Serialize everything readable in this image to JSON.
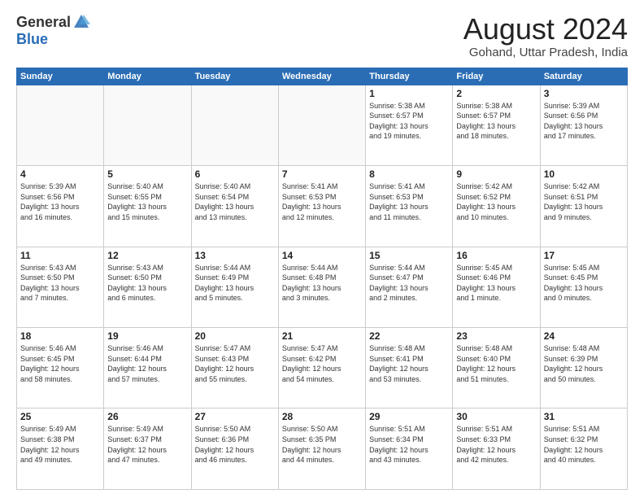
{
  "header": {
    "logo_general": "General",
    "logo_blue": "Blue",
    "title": "August 2024",
    "location": "Gohand, Uttar Pradesh, India"
  },
  "days_of_week": [
    "Sunday",
    "Monday",
    "Tuesday",
    "Wednesday",
    "Thursday",
    "Friday",
    "Saturday"
  ],
  "weeks": [
    [
      {
        "day": "",
        "info": ""
      },
      {
        "day": "",
        "info": ""
      },
      {
        "day": "",
        "info": ""
      },
      {
        "day": "",
        "info": ""
      },
      {
        "day": "1",
        "info": "Sunrise: 5:38 AM\nSunset: 6:57 PM\nDaylight: 13 hours\nand 19 minutes."
      },
      {
        "day": "2",
        "info": "Sunrise: 5:38 AM\nSunset: 6:57 PM\nDaylight: 13 hours\nand 18 minutes."
      },
      {
        "day": "3",
        "info": "Sunrise: 5:39 AM\nSunset: 6:56 PM\nDaylight: 13 hours\nand 17 minutes."
      }
    ],
    [
      {
        "day": "4",
        "info": "Sunrise: 5:39 AM\nSunset: 6:56 PM\nDaylight: 13 hours\nand 16 minutes."
      },
      {
        "day": "5",
        "info": "Sunrise: 5:40 AM\nSunset: 6:55 PM\nDaylight: 13 hours\nand 15 minutes."
      },
      {
        "day": "6",
        "info": "Sunrise: 5:40 AM\nSunset: 6:54 PM\nDaylight: 13 hours\nand 13 minutes."
      },
      {
        "day": "7",
        "info": "Sunrise: 5:41 AM\nSunset: 6:53 PM\nDaylight: 13 hours\nand 12 minutes."
      },
      {
        "day": "8",
        "info": "Sunrise: 5:41 AM\nSunset: 6:53 PM\nDaylight: 13 hours\nand 11 minutes."
      },
      {
        "day": "9",
        "info": "Sunrise: 5:42 AM\nSunset: 6:52 PM\nDaylight: 13 hours\nand 10 minutes."
      },
      {
        "day": "10",
        "info": "Sunrise: 5:42 AM\nSunset: 6:51 PM\nDaylight: 13 hours\nand 9 minutes."
      }
    ],
    [
      {
        "day": "11",
        "info": "Sunrise: 5:43 AM\nSunset: 6:50 PM\nDaylight: 13 hours\nand 7 minutes."
      },
      {
        "day": "12",
        "info": "Sunrise: 5:43 AM\nSunset: 6:50 PM\nDaylight: 13 hours\nand 6 minutes."
      },
      {
        "day": "13",
        "info": "Sunrise: 5:44 AM\nSunset: 6:49 PM\nDaylight: 13 hours\nand 5 minutes."
      },
      {
        "day": "14",
        "info": "Sunrise: 5:44 AM\nSunset: 6:48 PM\nDaylight: 13 hours\nand 3 minutes."
      },
      {
        "day": "15",
        "info": "Sunrise: 5:44 AM\nSunset: 6:47 PM\nDaylight: 13 hours\nand 2 minutes."
      },
      {
        "day": "16",
        "info": "Sunrise: 5:45 AM\nSunset: 6:46 PM\nDaylight: 13 hours\nand 1 minute."
      },
      {
        "day": "17",
        "info": "Sunrise: 5:45 AM\nSunset: 6:45 PM\nDaylight: 13 hours\nand 0 minutes."
      }
    ],
    [
      {
        "day": "18",
        "info": "Sunrise: 5:46 AM\nSunset: 6:45 PM\nDaylight: 12 hours\nand 58 minutes."
      },
      {
        "day": "19",
        "info": "Sunrise: 5:46 AM\nSunset: 6:44 PM\nDaylight: 12 hours\nand 57 minutes."
      },
      {
        "day": "20",
        "info": "Sunrise: 5:47 AM\nSunset: 6:43 PM\nDaylight: 12 hours\nand 55 minutes."
      },
      {
        "day": "21",
        "info": "Sunrise: 5:47 AM\nSunset: 6:42 PM\nDaylight: 12 hours\nand 54 minutes."
      },
      {
        "day": "22",
        "info": "Sunrise: 5:48 AM\nSunset: 6:41 PM\nDaylight: 12 hours\nand 53 minutes."
      },
      {
        "day": "23",
        "info": "Sunrise: 5:48 AM\nSunset: 6:40 PM\nDaylight: 12 hours\nand 51 minutes."
      },
      {
        "day": "24",
        "info": "Sunrise: 5:48 AM\nSunset: 6:39 PM\nDaylight: 12 hours\nand 50 minutes."
      }
    ],
    [
      {
        "day": "25",
        "info": "Sunrise: 5:49 AM\nSunset: 6:38 PM\nDaylight: 12 hours\nand 49 minutes."
      },
      {
        "day": "26",
        "info": "Sunrise: 5:49 AM\nSunset: 6:37 PM\nDaylight: 12 hours\nand 47 minutes."
      },
      {
        "day": "27",
        "info": "Sunrise: 5:50 AM\nSunset: 6:36 PM\nDaylight: 12 hours\nand 46 minutes."
      },
      {
        "day": "28",
        "info": "Sunrise: 5:50 AM\nSunset: 6:35 PM\nDaylight: 12 hours\nand 44 minutes."
      },
      {
        "day": "29",
        "info": "Sunrise: 5:51 AM\nSunset: 6:34 PM\nDaylight: 12 hours\nand 43 minutes."
      },
      {
        "day": "30",
        "info": "Sunrise: 5:51 AM\nSunset: 6:33 PM\nDaylight: 12 hours\nand 42 minutes."
      },
      {
        "day": "31",
        "info": "Sunrise: 5:51 AM\nSunset: 6:32 PM\nDaylight: 12 hours\nand 40 minutes."
      }
    ]
  ]
}
